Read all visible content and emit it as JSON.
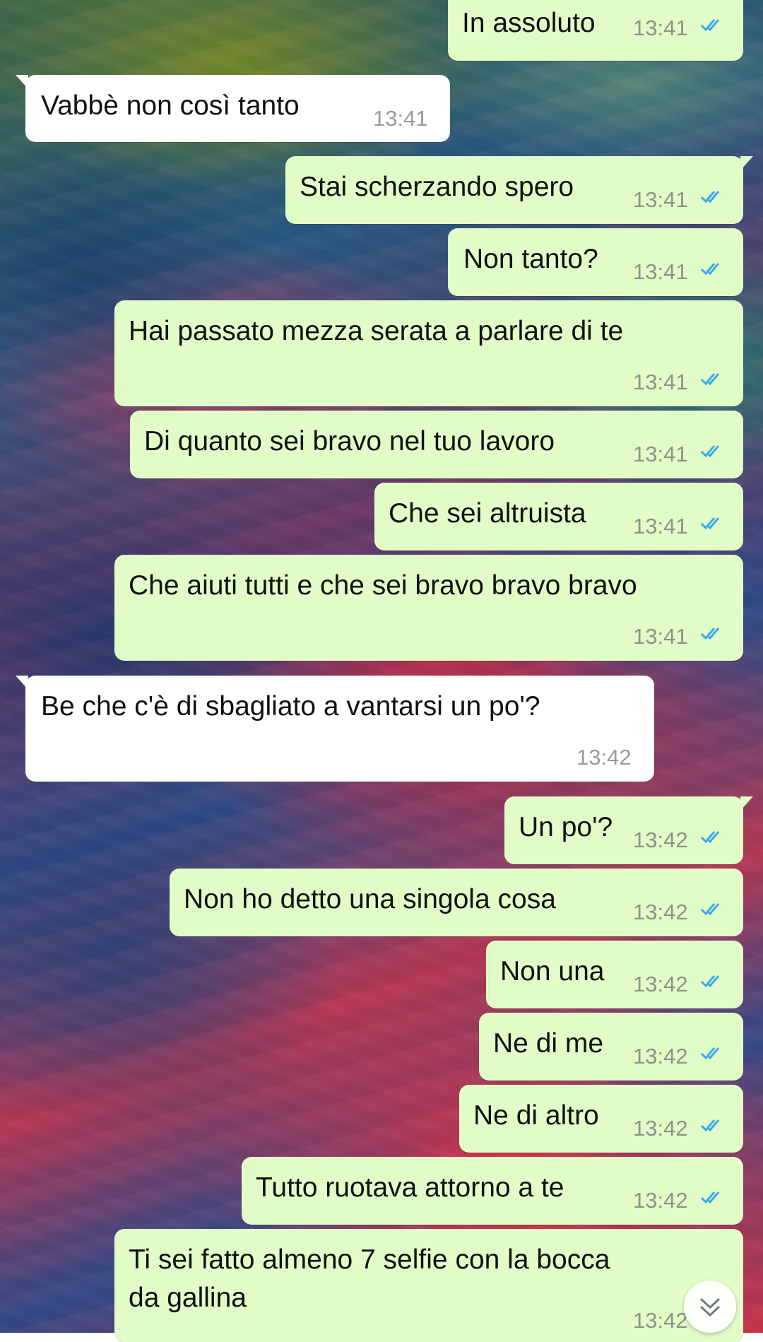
{
  "chat": {
    "messages": [
      {
        "direction": "sent",
        "text": "In assoluto",
        "time": "13:41",
        "status": "read"
      },
      {
        "direction": "received",
        "text": "Vabbè non così tanto",
        "time": "13:41"
      },
      {
        "direction": "sent",
        "text": "Stai scherzando spero",
        "time": "13:41",
        "status": "read"
      },
      {
        "direction": "sent",
        "text": "Non tanto?",
        "time": "13:41",
        "status": "read"
      },
      {
        "direction": "sent",
        "text": "Hai passato mezza serata a parlare di te",
        "time": "13:41",
        "status": "read"
      },
      {
        "direction": "sent",
        "text": "Di quanto sei bravo nel tuo lavoro",
        "time": "13:41",
        "status": "read"
      },
      {
        "direction": "sent",
        "text": "Che sei altruista",
        "time": "13:41",
        "status": "read"
      },
      {
        "direction": "sent",
        "text": "Che aiuti tutti e che sei bravo bravo bravo",
        "time": "13:41",
        "status": "read"
      },
      {
        "direction": "received",
        "text": "Be che c'è di sbagliato a vantarsi un po'?",
        "time": "13:42"
      },
      {
        "direction": "sent",
        "text": "Un po'?",
        "time": "13:42",
        "status": "read"
      },
      {
        "direction": "sent",
        "text": "Non ho detto una singola cosa",
        "time": "13:42",
        "status": "read"
      },
      {
        "direction": "sent",
        "text": "Non una",
        "time": "13:42",
        "status": "read"
      },
      {
        "direction": "sent",
        "text": "Ne di me",
        "time": "13:42",
        "status": "read"
      },
      {
        "direction": "sent",
        "text": "Ne di altro",
        "time": "13:42",
        "status": "read"
      },
      {
        "direction": "sent",
        "text": "Tutto ruotava attorno a te",
        "time": "13:42",
        "status": "read"
      },
      {
        "direction": "sent",
        "text_line1": "Ti sei fatto almeno 7 selfie con la bocca",
        "text_line2": "da gallina",
        "time": "13:42",
        "status": "read"
      }
    ]
  },
  "icons": {
    "read_receipt": "double-check-icon",
    "scroll_down": "chevron-double-down-icon"
  },
  "colors": {
    "sent_bubble": "#e2fcc8",
    "received_bubble": "#ffffff",
    "read_tick": "#3aa8f0",
    "timestamp": "#8c9387"
  }
}
